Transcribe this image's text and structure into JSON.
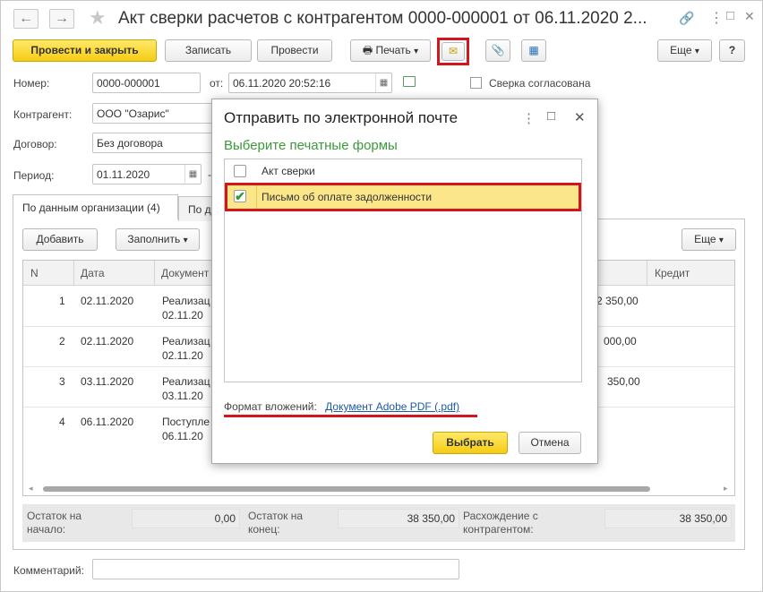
{
  "window": {
    "title": "Акт сверки расчетов с контрагентом 0000-000001 от 06.11.2020 2...",
    "back_glyph": "←",
    "forward_glyph": "→",
    "star_glyph": "★",
    "link_glyph": "🔗",
    "more_glyph": "⋮",
    "maximize_glyph": "□",
    "close_glyph": "✕"
  },
  "toolbar": {
    "post_close": "Провести и закрыть",
    "save": "Записать",
    "post": "Провести",
    "print": "Печать",
    "more": "Еще",
    "help": "?",
    "dropdown_glyph": "▾",
    "print_glyph": "🖶",
    "email_glyph": "✉",
    "attach_glyph": "📎",
    "structure_glyph": "▦"
  },
  "form": {
    "number_label": "Номер:",
    "number_value": "0000-000001",
    "from_label": "от:",
    "date_value": "06.11.2020 20:52:16",
    "reconciled_label": "Сверка согласована",
    "counterparty_label": "Контрагент:",
    "counterparty_value": "ООО \"Озарис\"",
    "contract_label": "Договор:",
    "contract_value": "Без договора",
    "period_label": "Период:",
    "period_from": "01.11.2020",
    "period_dash": "-",
    "calendar_glyph": "▦",
    "comment_label": "Комментарий:"
  },
  "tabs": [
    {
      "label": "По данным организации (4)"
    },
    {
      "label": "По д"
    }
  ],
  "grid_toolbar": {
    "add": "Добавить",
    "fill": "Заполнить",
    "more": "Еще",
    "dropdown_glyph": "▾"
  },
  "grid": {
    "columns": {
      "n": "N",
      "date": "Дата",
      "document": "Документ",
      "credit": "Кредит"
    },
    "rows": [
      {
        "n": "1",
        "date": "02.11.2020",
        "doc1": "Реализац",
        "doc2": "02.11.20",
        "amount": "2 350,00"
      },
      {
        "n": "2",
        "date": "02.11.2020",
        "doc1": "Реализац",
        "doc2": "02.11.20",
        "amount": "000,00"
      },
      {
        "n": "3",
        "date": "03.11.2020",
        "doc1": "Реализац",
        "doc2": "03.11.20",
        "amount": "350,00"
      },
      {
        "n": "4",
        "date": "06.11.2020",
        "doc1": "Поступле",
        "doc2": "06.11.20",
        "amount": ""
      }
    ],
    "scroll_left_glyph": "◂",
    "scroll_right_glyph": "▸"
  },
  "footer": {
    "start_label_1": "Остаток на",
    "start_label_2": "начало:",
    "start_value": "0,00",
    "end_label_1": "Остаток на",
    "end_label_2": "конец:",
    "end_value": "38 350,00",
    "diff_label_1": "Расхождение с",
    "diff_label_2": "контрагентом:",
    "diff_value": "38 350,00"
  },
  "dialog": {
    "title": "Отправить по электронной почте",
    "subtitle": "Выберите печатные формы",
    "more_glyph": "⋮",
    "maximize_glyph": "□",
    "close_glyph": "✕",
    "items": [
      {
        "label": "Акт сверки",
        "checked": false
      },
      {
        "label": "Письмо об оплате задолженности",
        "checked": true
      }
    ],
    "check_glyph": "✔",
    "format_label": "Формат вложений:",
    "format_value": "Документ Adobe PDF (.pdf)",
    "select": "Выбрать",
    "cancel": "Отмена"
  },
  "colors": {
    "accent_yellow": "#f5cc14",
    "highlight_red": "#d2161e",
    "selected_row": "#fbe78a",
    "subtitle_green": "#3a9a3a",
    "link_blue": "#1d5aa6"
  }
}
